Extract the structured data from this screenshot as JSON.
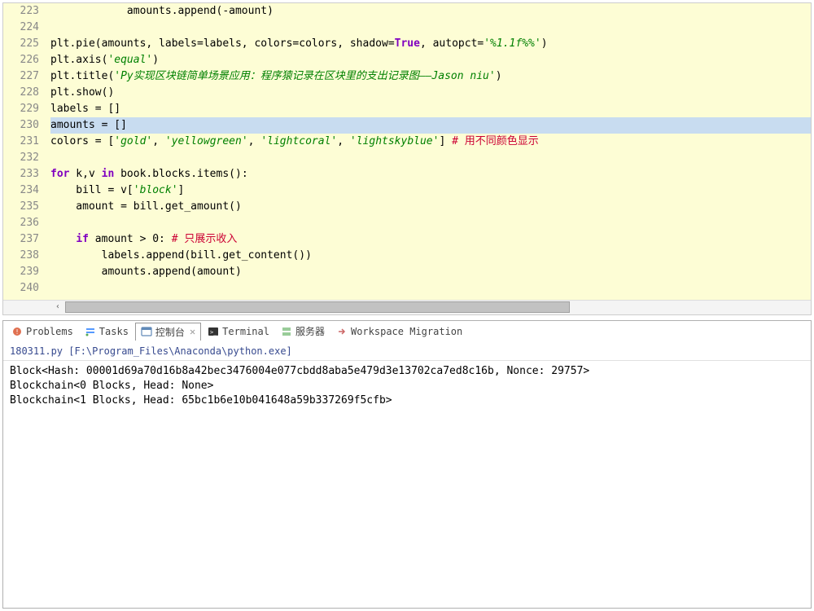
{
  "editor": {
    "lines": [
      {
        "n": 223,
        "html": "            amounts.append(-amount)"
      },
      {
        "n": 224,
        "html": ""
      },
      {
        "n": 225,
        "html": "plt.pie(amounts, labels=labels, colors=colors, shadow=<span class='kw'>True</span>, autopct=<span class='str'>'%1.1f%%'</span>)"
      },
      {
        "n": 226,
        "html": "plt.axis(<span class='str'>'equal'</span>)"
      },
      {
        "n": 227,
        "html": "plt.title(<span class='str'>'Py实现区块链简单场景应用：程序猿记录在区块里的支出记录图——Jason niu'</span>)"
      },
      {
        "n": 228,
        "html": "plt.show()"
      },
      {
        "n": 229,
        "html": "labels = []"
      },
      {
        "n": 230,
        "html": "amounts = [<span style='background:#c8dcf0'>]</span>",
        "hl": true
      },
      {
        "n": 231,
        "html": "colors = [<span class='str'>'gold'</span>, <span class='str'>'yellowgreen'</span>, <span class='str'>'lightcoral'</span>, <span class='str'>'lightskyblue'</span>] <span class='cmt'># 用不同颜色显示</span>"
      },
      {
        "n": 232,
        "html": ""
      },
      {
        "n": 233,
        "html": "<span class='kw'>for</span> k,v <span class='kw'>in</span> book.blocks.items():"
      },
      {
        "n": 234,
        "html": "    bill = v[<span class='str'>'block'</span>]"
      },
      {
        "n": 235,
        "html": "    amount = bill.get_amount()"
      },
      {
        "n": 236,
        "html": ""
      },
      {
        "n": 237,
        "html": "    <span class='kw'>if</span> amount &gt; 0: <span class='cmt'># 只展示收入</span>"
      },
      {
        "n": 238,
        "html": "        labels.append(bill.get_content())"
      },
      {
        "n": 239,
        "html": "        amounts.append(amount)"
      },
      {
        "n": 240,
        "html": ""
      }
    ]
  },
  "tabs": {
    "problems": "Problems",
    "tasks": "Tasks",
    "console": "控制台",
    "terminal": "Terminal",
    "servers": "服务器",
    "migration": "Workspace Migration"
  },
  "console": {
    "title": "180311.py [F:\\Program_Files\\Anaconda\\python.exe]",
    "output": "Block<Hash: 00001d69a70d16b8a42bec3476004e077cbdd8aba5e479d3e13702ca7ed8c16b, Nonce: 29757>\nBlockchain<0 Blocks, Head: None>\nBlockchain<1 Blocks, Head: 65bc1b6e10b041648a59b337269f5cfb>"
  }
}
